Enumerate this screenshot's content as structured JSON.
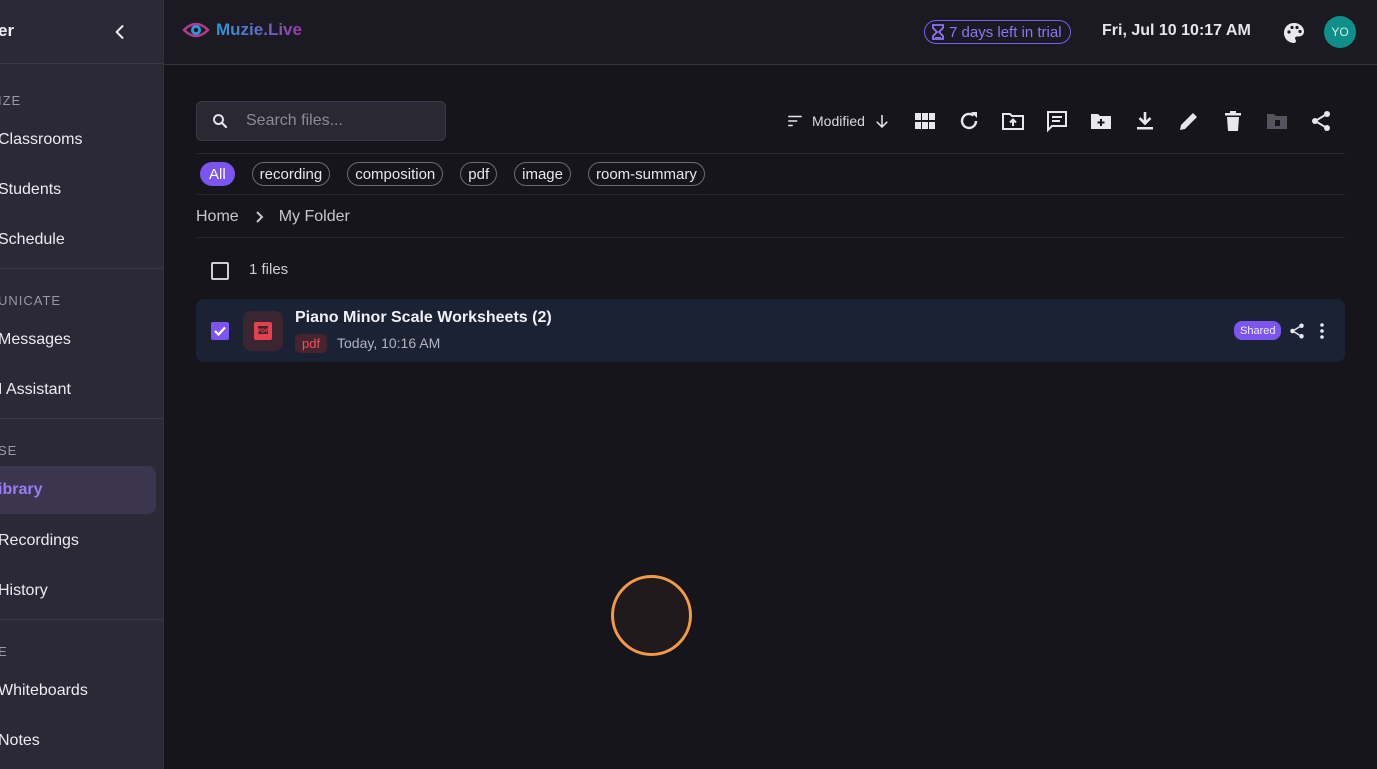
{
  "sidebar": {
    "title": "er",
    "sections": [
      {
        "label": "IZE",
        "items": [
          "Classrooms",
          "Students",
          "Schedule"
        ]
      },
      {
        "label": "UNICATE",
        "items": [
          "Messages",
          "I Assistant"
        ]
      },
      {
        "label": "SE",
        "items": [
          "ibrary",
          "Recordings",
          "History"
        ]
      },
      {
        "label": "E",
        "items": [
          "Whiteboards",
          "Notes"
        ]
      }
    ],
    "active_item": "ibrary"
  },
  "topbar": {
    "logo_text": "Muzie.Live",
    "trial_label": "7 days left in trial",
    "datetime": "Fri, Jul 10 10:17 AM",
    "avatar_initials": "YO"
  },
  "search": {
    "placeholder": "Search files..."
  },
  "toolbar": {
    "sort_label": "Modified",
    "icons": [
      "grid-view-icon",
      "refresh-icon",
      "upload-folder-icon",
      "comment-icon",
      "new-folder-icon",
      "download-icon",
      "rename-icon",
      "delete-icon",
      "archive-icon",
      "share-icon"
    ]
  },
  "filters": [
    "All",
    "recording",
    "composition",
    "pdf",
    "image",
    "room-summary"
  ],
  "active_filter": "All",
  "breadcrumb": {
    "home": "Home",
    "current": "My Folder"
  },
  "file_count": "1 files",
  "files": [
    {
      "name": "Piano Minor Scale Worksheets (2)",
      "type": "pdf",
      "date": "Today, 10:16 AM",
      "badge": "Shared",
      "selected": true
    }
  ],
  "colors": {
    "accent": "#7b55ee",
    "pdf": "#ee4f5c",
    "cursor_ring": "#f29a45"
  }
}
